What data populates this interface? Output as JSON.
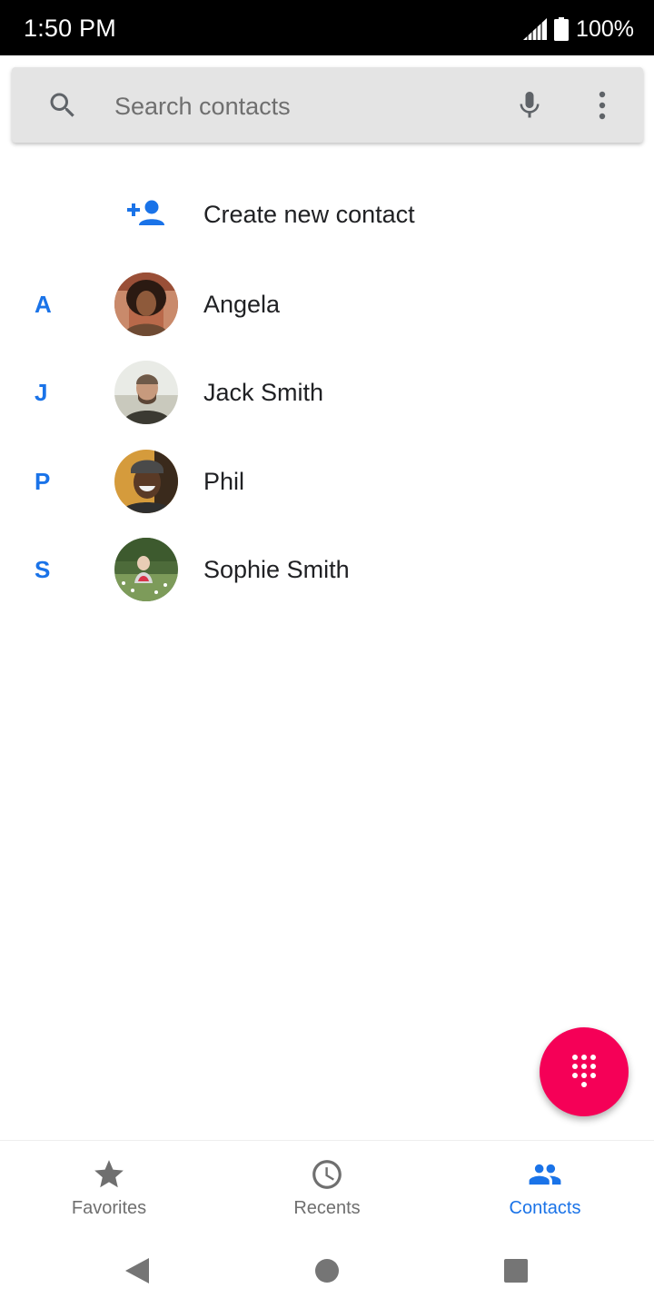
{
  "status_bar": {
    "time": "1:50 PM",
    "battery": "100%"
  },
  "search": {
    "placeholder": "Search contacts",
    "value": ""
  },
  "create_contact": {
    "label": "Create new contact"
  },
  "contacts": [
    {
      "letter": "A",
      "name": "Angela"
    },
    {
      "letter": "J",
      "name": "Jack Smith"
    },
    {
      "letter": "P",
      "name": "Phil"
    },
    {
      "letter": "S",
      "name": "Sophie Smith"
    }
  ],
  "bottom_nav": {
    "items": [
      {
        "label": "Favorites",
        "icon": "star-icon",
        "active": false
      },
      {
        "label": "Recents",
        "icon": "clock-icon",
        "active": false
      },
      {
        "label": "Contacts",
        "icon": "people-icon",
        "active": true
      }
    ]
  },
  "colors": {
    "accent": "#1a73e8",
    "fab": "#f50057",
    "search_bg": "#e4e4e4",
    "status_bar_bg": "#000000"
  }
}
